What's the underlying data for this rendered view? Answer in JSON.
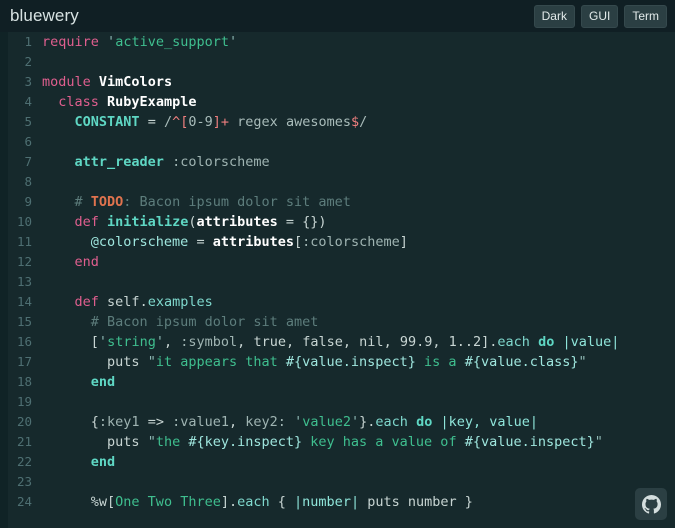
{
  "header": {
    "title": "bluewery",
    "buttons": [
      {
        "label": "Dark",
        "name": "dark-button"
      },
      {
        "label": "GUI",
        "name": "gui-button"
      },
      {
        "label": "Term",
        "name": "term-button"
      }
    ]
  },
  "colors": {
    "header_bg": "#101f24",
    "code_bg": "#16292c",
    "gutter_text": "#4e6f72",
    "left_rail": "#102326",
    "button_bg": "#2b3f43",
    "keyword": "#e05f8f",
    "constant": "#5fd7c4",
    "string": "#3fbf8f",
    "comment": "#5d7d7c",
    "todo": "#e0734e",
    "regex_op": "#ef7f7f",
    "default_text": "#c8d5d3"
  },
  "editor": {
    "language": "ruby",
    "first_line": 1,
    "last_line": 24,
    "lines": [
      {
        "n": "1",
        "text": "require 'active_support'"
      },
      {
        "n": "2",
        "text": ""
      },
      {
        "n": "3",
        "text": "module VimColors"
      },
      {
        "n": "4",
        "text": "  class RubyExample"
      },
      {
        "n": "5",
        "text": "    CONSTANT = /^[0-9]+ regex awesomes$/"
      },
      {
        "n": "6",
        "text": ""
      },
      {
        "n": "7",
        "text": "    attr_reader :colorscheme"
      },
      {
        "n": "8",
        "text": ""
      },
      {
        "n": "9",
        "text": "    # TODO: Bacon ipsum dolor sit amet"
      },
      {
        "n": "10",
        "text": "    def initialize(attributes = {})"
      },
      {
        "n": "11",
        "text": "      @colorscheme = attributes[:colorscheme]"
      },
      {
        "n": "12",
        "text": "    end"
      },
      {
        "n": "13",
        "text": ""
      },
      {
        "n": "14",
        "text": "    def self.examples"
      },
      {
        "n": "15",
        "text": "      # Bacon ipsum dolor sit amet"
      },
      {
        "n": "16",
        "text": "      ['string', :symbol, true, false, nil, 99.9, 1..2].each do |value|"
      },
      {
        "n": "17",
        "text": "        puts \"it appears that #{value.inspect} is a #{value.class}\""
      },
      {
        "n": "18",
        "text": "      end"
      },
      {
        "n": "19",
        "text": ""
      },
      {
        "n": "20",
        "text": "      {:key1 => :value1, key2: 'value2'}.each do |key, value|"
      },
      {
        "n": "21",
        "text": "        puts \"the #{key.inspect} key has a value of #{value.inspect}\""
      },
      {
        "n": "22",
        "text": "      end"
      },
      {
        "n": "23",
        "text": ""
      },
      {
        "n": "24",
        "text": "      %w[One Two Three].each { |number| puts number }"
      }
    ]
  },
  "github": {
    "icon": "github-icon",
    "label": "GitHub"
  }
}
